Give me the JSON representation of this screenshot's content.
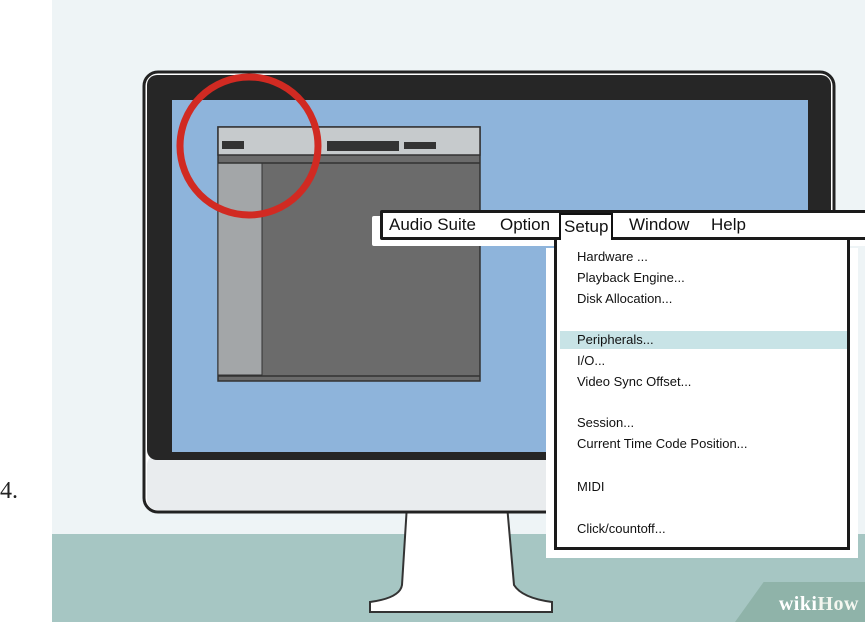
{
  "step_number": "4.",
  "menubar": {
    "items": [
      "Audio Suite",
      "Option",
      "Setup",
      "Window",
      "Help"
    ],
    "active": "Setup"
  },
  "dropdown": {
    "items": [
      "Hardware ...",
      "Playback Engine...",
      "Disk Allocation...",
      "Peripherals...",
      "I/O...",
      "Video Sync Offset...",
      "Session...",
      "Current Time Code Position...",
      "MIDI",
      "Click/countoff..."
    ],
    "highlighted": "Peripherals..."
  },
  "watermark": {
    "wiki": "wiki",
    "how": "How"
  },
  "colors": {
    "screen_blue": "#8eb4db",
    "highlight": "#c8e3e6",
    "circle_red": "#d12a22",
    "floor": "#a6c6c3"
  }
}
